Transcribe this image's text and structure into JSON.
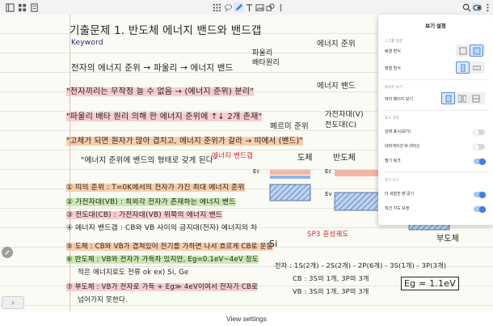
{
  "toolbar": {
    "left_icons": [
      "page-thumbnails-icon",
      "grid-icon",
      "pen-add-icon"
    ],
    "center_icons": [
      "apps-icon",
      "lasso-icon",
      "pen-icon",
      "text-icon",
      "image-icon",
      "shape-icon",
      "more-icon"
    ],
    "right_icons": [
      "search-icon",
      "view-settings-icon",
      "more-options-icon"
    ]
  },
  "note": {
    "title": "기출문제 1. 반도체 에너지 밴드와 밴드갭",
    "keyword": "Keyword",
    "line1": "전자의 에너지 준위 → 파울리 → 에너지 밴드",
    "line2": "\"전자끼리는 무작정 늘 수 없음 → (에너지 준위) 분리\"",
    "line3": "\"파울리 배타 원리 의해 한 에너지 준위에 ↑↓ 2개 존재\"",
    "line4": "\"고체가 되면 원자가 많아 겹치고, 에너지 준위가 갈라 → 띠에서 (밴드)\"",
    "line5": "\"에너지 준위에 밴드의 형태로 갖게 된다\"",
    "list1": "① 띠의 준위 : T=0K에서의 전자가 가진 최대 에너지 준위",
    "list2": "② 가전자대(VB) : 최외각 전자가 존재하는 에너지 밴드",
    "list3": "③ 전도대(CB) : 가전자대(VB) 위쪽의 에너지 밴드",
    "list4": "④ 에너지 밴드갭 : CB와 VB 사이의 금지대(전자) 에너지의 차",
    "list5": "⑤ 도체 : CB와 VB가 겹쳐있어 전기를 가하면 나서 흐르게 CB로 운동",
    "list6": "⑥ 반도체 : VB와 전자가 가득차 있지만, Eg=0.1eV~4eV 정도",
    "list6b": "적은 에너지로도 전류 ok   ex) Si, Ge",
    "list7": "⑦ 부도체 : VB가 전자로 가득 + Eg≫ 4eV이여서 전자가 CB로",
    "list7b": "넘어가지 못한다.",
    "label_pauli": "파울리\n배타원리",
    "label_energy_level": "에너지 준위",
    "label_energy_band": "에너지 밴드",
    "label_fermi": "페르미 준위",
    "label_vb_cb": "가전자대(V)\n전도대(C)",
    "label_bandgap": "에너지 밴드갭",
    "label_conductor": "도체",
    "label_semiconductor": "반도체",
    "label_insulator": "부도체",
    "label_sp3": "SP3 혼성궤도",
    "formula1": "전자 : 1S(2개) - 2S(2개) - 2P(6개) - 3S(1개) - 3P(3개)",
    "formula2": "CB : 3S의 1개, 3P의 3개",
    "formula3": "VB : 3S의 1개, 3P의 3개",
    "eg_value": "Eg = 1.1eV",
    "ec_label": "Ec",
    "ev_label": "Ev",
    "eg_label": "Eg",
    "si_label": "Si"
  },
  "panel": {
    "title": "보기 설정",
    "section_scroll": "스크롤 방향",
    "option_bg": "배경 방식",
    "option_layout": "정렬 방식",
    "section_page": "페이지 보기",
    "option_multi": "여러 페이지 보기",
    "section_display": "표시 설정",
    "option_toggle1": "상태 표시(보기)",
    "option_toggle2": "네비게이션 바 (하단)",
    "option_toggle3": "필기 링크",
    "section_etc": "필기 도구",
    "option_toggle4": "더 세밀한 펜 굵기",
    "option_toggle5": "직선 각도 보정",
    "toggles": [
      false,
      false,
      true,
      true,
      true
    ]
  },
  "caption": "View settings",
  "page_toggle": "›"
}
